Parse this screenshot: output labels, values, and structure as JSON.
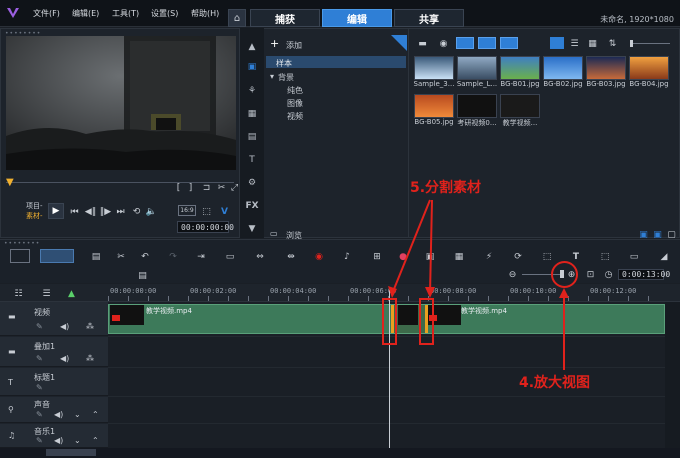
{
  "titlebar": {
    "menu": [
      "文件(F)",
      "编辑(E)",
      "工具(T)",
      "设置(S)",
      "帮助(H)"
    ],
    "tabs": [
      "捕获",
      "编辑",
      "共享"
    ],
    "active_tab": "编辑",
    "project_info": "未命名, 1920*1080"
  },
  "player": {
    "mode_labels": [
      "项目-",
      "素材-"
    ],
    "timecode": "00:00:00:00",
    "format_label": "16:9"
  },
  "library": {
    "add_label": "添加",
    "tree": [
      "样本",
      "背景",
      "纯色",
      "图像",
      "视频"
    ],
    "browse_label": "浏览",
    "media": [
      {
        "label": "Sample_3...",
        "color": "#3b5a7a"
      },
      {
        "label": "Sample_L...",
        "color": "#8fa9c3"
      },
      {
        "label": "BG-B01.jpg",
        "color": "#3f7fc2"
      },
      {
        "label": "BG-B02.jpg",
        "color": "#2a6fc8"
      },
      {
        "label": "BG-B03.jpg",
        "color": "#c76a3a"
      },
      {
        "label": "BG-B04.jpg",
        "color": "#d97b2e"
      },
      {
        "label": "BG-B05.jpg",
        "color": "#b84a1f"
      },
      {
        "label": "考研视频0...",
        "color": "#111111"
      },
      {
        "label": "教学视频...",
        "color": "#1a1a1a"
      }
    ]
  },
  "timeline": {
    "ruler": [
      "00:00:00:00",
      "00:00:02:00",
      "00:00:04:00",
      "00:00:06:00",
      "00:00:08:00",
      "00:00:10:00",
      "00:00:12:00"
    ],
    "zoom_timecode": "0:00:13:00",
    "tracks": [
      "视频",
      "叠加1",
      "标题1",
      "声音",
      "音乐1"
    ],
    "clips": [
      {
        "label": "教学视频.mp4"
      },
      {
        "label": "教学视频.mp4"
      }
    ]
  },
  "annotations": {
    "split": "5.分割素材",
    "zoom": "4.放大视图"
  },
  "colors": {
    "accent": "#2f7fd6",
    "clip": "#3d7a5a",
    "annotation": "#e0221c"
  }
}
